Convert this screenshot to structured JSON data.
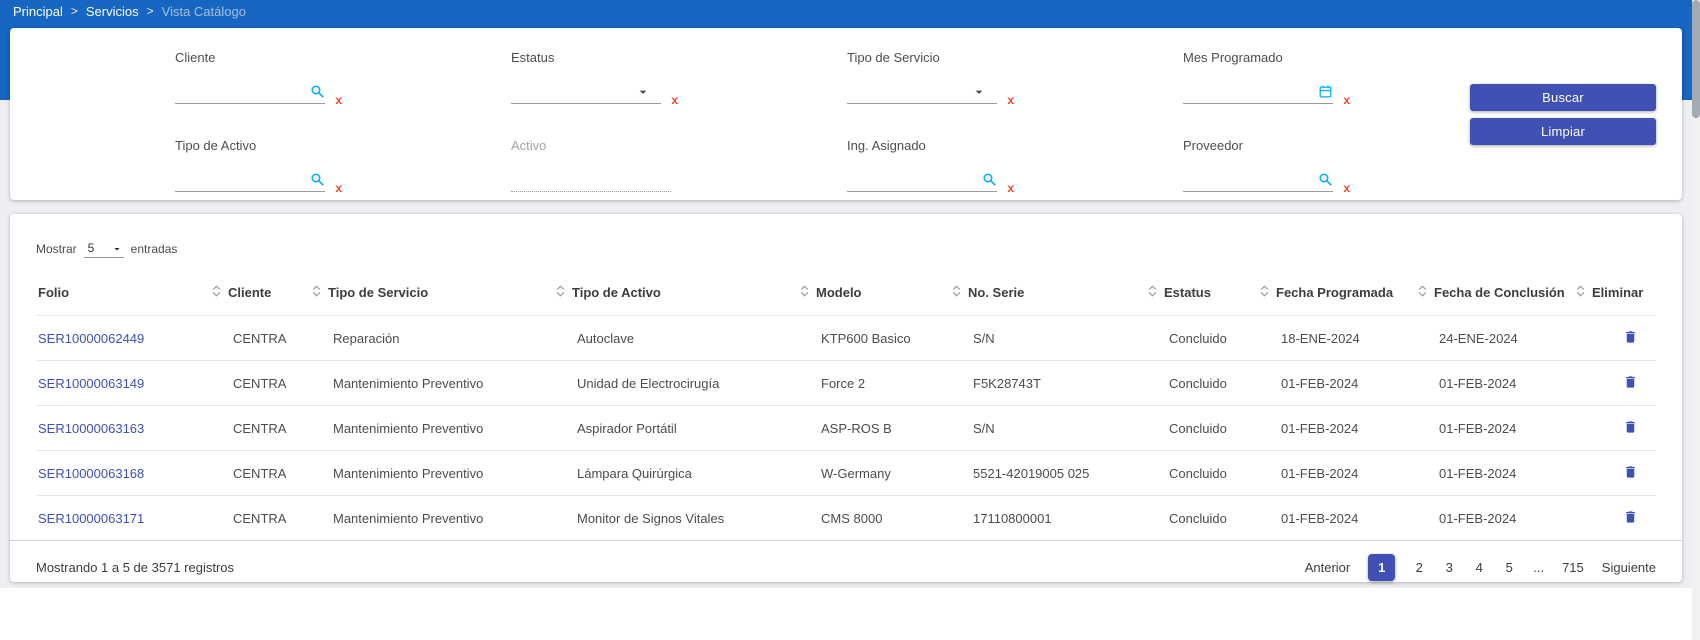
{
  "colors": {
    "header_band": "#1666c2",
    "primary_button": "#3f51b5",
    "search_icon": "#00b0f0",
    "clear_icon": "#f44336",
    "link": "#3f51b5",
    "active_page_bg": "#3f51b5"
  },
  "breadcrumb": {
    "separator": ">",
    "items": [
      "Principal",
      "Servicios",
      "Vista Catálogo"
    ]
  },
  "filters": {
    "clear_label": "x",
    "fields": [
      {
        "label": "Cliente",
        "type": "search"
      },
      {
        "label": "Estatus",
        "type": "select"
      },
      {
        "label": "Tipo de Servicio",
        "type": "select"
      },
      {
        "label": "Mes Programado",
        "type": "date"
      },
      {
        "label": "Tipo de Activo",
        "type": "search"
      },
      {
        "label": "Activo",
        "type": "text_disabled"
      },
      {
        "label": "Ing. Asignado",
        "type": "search"
      },
      {
        "label": "Proveedor",
        "type": "search"
      }
    ],
    "buttons": {
      "buscar": "Buscar",
      "limpiar": "Limpiar"
    }
  },
  "table": {
    "length_control": {
      "prefix": "Mostrar",
      "value": "5",
      "suffix": "entradas"
    },
    "columns": [
      "Folio",
      "Cliente",
      "Tipo de Servicio",
      "Tipo de Activo",
      "Modelo",
      "No. Serie",
      "Estatus",
      "Fecha Programada",
      "Fecha de Conclusión",
      "Eliminar"
    ],
    "rows": [
      {
        "folio": "SER10000062449",
        "cliente": "CENTRA",
        "tipo_de_servicio": "Reparación",
        "tipo_de_activo": "Autoclave",
        "modelo": "KTP600 Basico",
        "no_serie": "S/N",
        "estatus": "Concluido",
        "fecha_programada": "18-ENE-2024",
        "fecha_de_conclusion": "24-ENE-2024"
      },
      {
        "folio": "SER10000063149",
        "cliente": "CENTRA",
        "tipo_de_servicio": "Mantenimiento Preventivo",
        "tipo_de_activo": "Unidad de Electrocirugía",
        "modelo": "Force 2",
        "no_serie": "F5K28743T",
        "estatus": "Concluido",
        "fecha_programada": "01-FEB-2024",
        "fecha_de_conclusion": "01-FEB-2024"
      },
      {
        "folio": "SER10000063163",
        "cliente": "CENTRA",
        "tipo_de_servicio": "Mantenimiento Preventivo",
        "tipo_de_activo": "Aspirador Portátil",
        "modelo": "ASP-ROS B",
        "no_serie": "S/N",
        "estatus": "Concluido",
        "fecha_programada": "01-FEB-2024",
        "fecha_de_conclusion": "01-FEB-2024"
      },
      {
        "folio": "SER10000063168",
        "cliente": "CENTRA",
        "tipo_de_servicio": "Mantenimiento Preventivo",
        "tipo_de_activo": "Lámpara Quirúrgica",
        "modelo": "W-Germany",
        "no_serie": "5521-42019005 025",
        "estatus": "Concluido",
        "fecha_programada": "01-FEB-2024",
        "fecha_de_conclusion": "01-FEB-2024"
      },
      {
        "folio": "SER10000063171",
        "cliente": "CENTRA",
        "tipo_de_servicio": "Mantenimiento Preventivo",
        "tipo_de_activo": "Monitor de Signos Vitales",
        "modelo": "CMS 8000",
        "no_serie": "17110800001",
        "estatus": "Concluido",
        "fecha_programada": "01-FEB-2024",
        "fecha_de_conclusion": "01-FEB-2024"
      }
    ],
    "footer": {
      "summary": "Mostrando 1 a 5 de 3571 registros",
      "pagination": {
        "previous": "Anterior",
        "pages": [
          "1",
          "2",
          "3",
          "4",
          "5",
          "...",
          "715"
        ],
        "active_page": "1",
        "next": "Siguiente"
      }
    }
  }
}
